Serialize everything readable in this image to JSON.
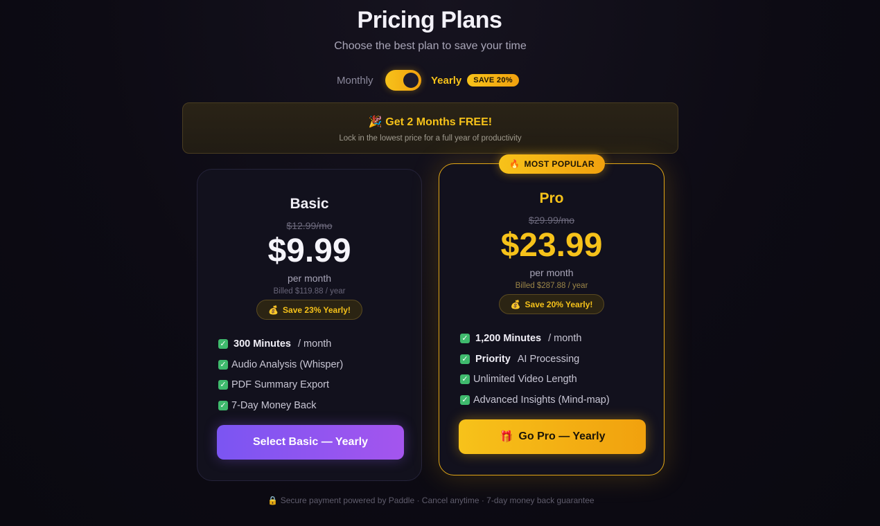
{
  "header": {
    "title": "Pricing Plans",
    "subtitle": "Choose the best plan to save your time"
  },
  "billing_toggle": {
    "monthly_label": "Monthly",
    "yearly_label": "Yearly",
    "save_badge": "SAVE 20%",
    "selected": "Yearly"
  },
  "promo": {
    "icon": "🎉",
    "title": "Get 2 Months FREE!",
    "subtitle": "Lock in the lowest price for a full year of productivity"
  },
  "plans": {
    "basic": {
      "name": "Basic",
      "old_price": "$12.99/mo",
      "price": "$9.99",
      "per": "per month",
      "billed": "Billed $119.88 / year",
      "save_icon": "💰",
      "save_text": "Save 23% Yearly!",
      "features": [
        {
          "strong": "300 Minutes",
          "text": "/ month"
        },
        {
          "strong": "",
          "text": "Audio Analysis (Whisper)"
        },
        {
          "strong": "",
          "text": "PDF Summary Export"
        },
        {
          "strong": "",
          "text": "7-Day Money Back"
        }
      ],
      "cta": "Select Basic — Yearly"
    },
    "pro": {
      "badge_icon": "🔥",
      "badge": "MOST POPULAR",
      "name": "Pro",
      "old_price": "$29.99/mo",
      "price": "$23.99",
      "per": "per month",
      "billed": "Billed $287.88 / year",
      "save_icon": "💰",
      "save_text": "Save 20% Yearly!",
      "features": [
        {
          "strong": "1,200 Minutes",
          "text": "/ month"
        },
        {
          "strong": "Priority",
          "text": "AI Processing"
        },
        {
          "strong": "",
          "text": "Unlimited Video Length"
        },
        {
          "strong": "",
          "text": "Advanced Insights (Mind-map)"
        }
      ],
      "cta_icon": "🎁",
      "cta": "Go Pro — Yearly"
    }
  },
  "footer": {
    "icon": "🔒",
    "text": "Secure payment powered by Paddle · Cancel anytime · 7-day money back guarantee"
  },
  "colors": {
    "accent": "#f6c21a",
    "basic_cta": "#8a55f0",
    "check": "#3fba6d",
    "background": "#0d0b14"
  }
}
